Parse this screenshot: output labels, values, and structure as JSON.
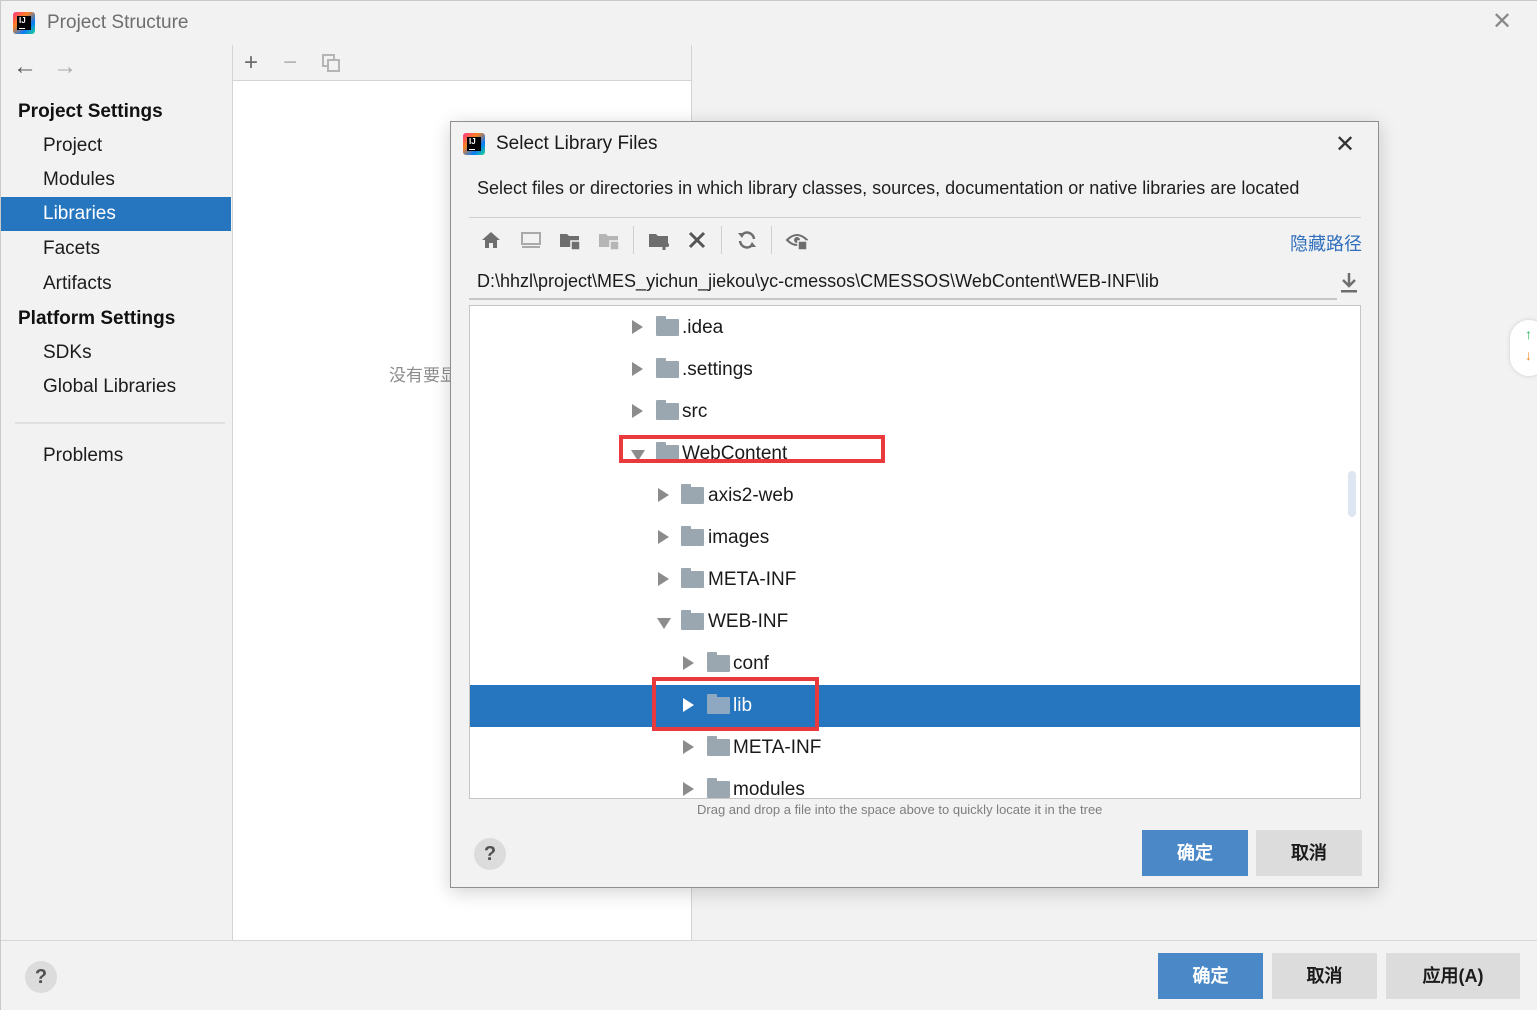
{
  "window": {
    "title": "Project Structure",
    "close_glyph": "✕"
  },
  "nav": {
    "back_glyph": "←",
    "forward_glyph": "→",
    "sections": [
      {
        "heading": "Project Settings",
        "items": [
          "Project",
          "Modules",
          "Libraries",
          "Facets",
          "Artifacts"
        ]
      },
      {
        "heading": "Platform Settings",
        "items": [
          "SDKs",
          "Global Libraries"
        ]
      }
    ],
    "extra_items": [
      "Problems"
    ],
    "selected_item": "Libraries"
  },
  "middle_panel": {
    "toolbar": {
      "add_glyph": "+",
      "remove_glyph": "−"
    },
    "empty_text": "没有要显"
  },
  "dialog": {
    "title": "Select Library Files",
    "close_glyph": "✕",
    "description": "Select files or directories in which library classes, sources, documentation or native libraries are located",
    "hide_path_link": "隐藏路径",
    "toolbar_icons": [
      "home-icon",
      "desktop-icon",
      "project-folder-icon",
      "module-folder-icon",
      "new-folder-icon",
      "delete-icon",
      "refresh-icon",
      "show-hidden-icon"
    ],
    "path": "D:\\hhzl\\project\\MES_yichun_jiekou\\yc-cmessos\\CMESSOS\\WebContent\\WEB-INF\\lib",
    "tree": [
      {
        "label": ".idea",
        "depth": 0,
        "expanded": false
      },
      {
        "label": ".settings",
        "depth": 0,
        "expanded": false
      },
      {
        "label": "src",
        "depth": 0,
        "expanded": false
      },
      {
        "label": "WebContent",
        "depth": 0,
        "expanded": true
      },
      {
        "label": "axis2-web",
        "depth": 1,
        "expanded": false
      },
      {
        "label": "images",
        "depth": 1,
        "expanded": false
      },
      {
        "label": "META-INF",
        "depth": 1,
        "expanded": false
      },
      {
        "label": "WEB-INF",
        "depth": 1,
        "expanded": true
      },
      {
        "label": "conf",
        "depth": 2,
        "expanded": false
      },
      {
        "label": "lib",
        "depth": 2,
        "expanded": false,
        "selected": true
      },
      {
        "label": "META-INF",
        "depth": 2,
        "expanded": false
      },
      {
        "label": "modules",
        "depth": 2,
        "expanded": false
      }
    ],
    "drag_hint": "Drag and drop a file into the space above to quickly locate it in the tree",
    "help_label": "?",
    "ok_label": "确定",
    "cancel_label": "取消"
  },
  "bottom_bar": {
    "help_label": "?",
    "ok_label": "确定",
    "cancel_label": "取消",
    "apply_label": "应用(A)"
  },
  "colors": {
    "selection": "#2675bf",
    "primary_button": "#4a88c7",
    "highlight_box": "#e8393d",
    "link": "#2f6fbd"
  }
}
